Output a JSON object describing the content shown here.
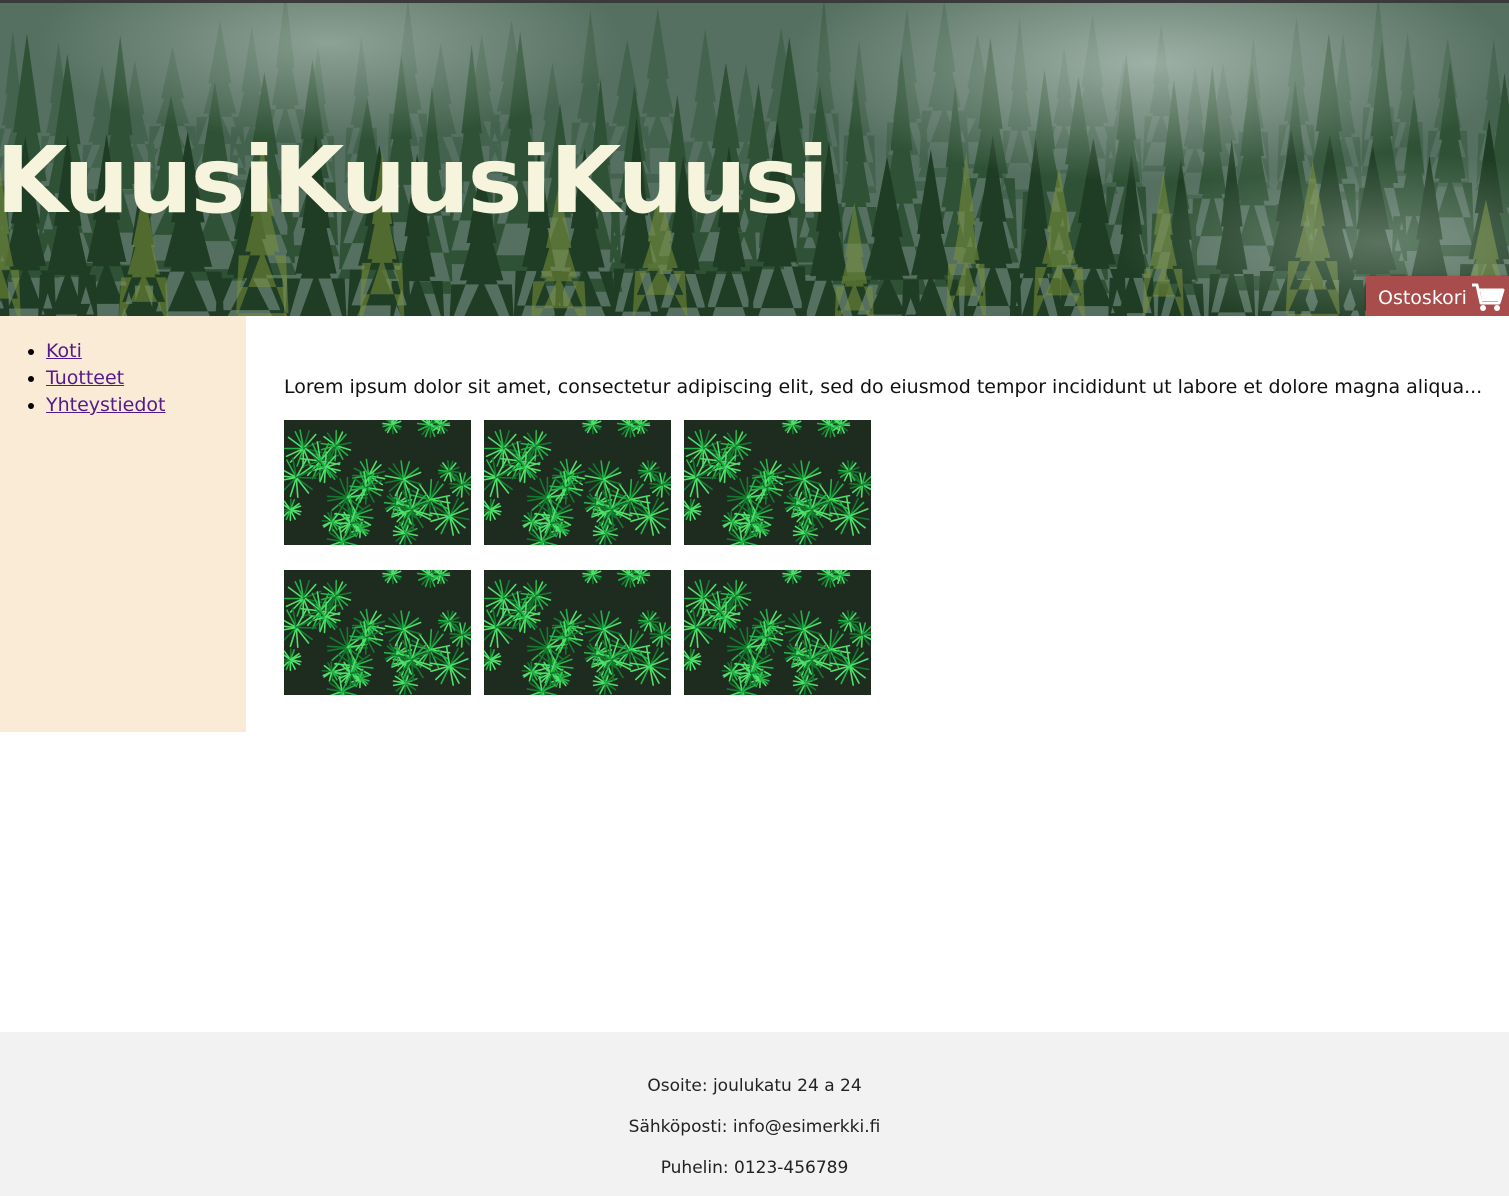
{
  "header": {
    "title": "KuusiKuusiKuusi",
    "cart_label": "Ostoskori"
  },
  "nav": {
    "items": [
      {
        "label": "Koti"
      },
      {
        "label": "Tuotteet"
      },
      {
        "label": "Yhteystiedot"
      }
    ]
  },
  "main": {
    "intro": "Lorem ipsum dolor sit amet, consectetur adipiscing elit, sed do eiusmod tempor incididunt ut labore et dolore magna aliqua..."
  },
  "footer": {
    "address": "Osoite: joulukatu 24 a 24",
    "email": "Sähköposti: info@esimerkki.fi",
    "phone": "Puhelin: 0123-456789"
  },
  "colors": {
    "title": "#f6f4dc",
    "cart_button": "#a84c4c",
    "sidebar": "#faebd7",
    "link_visited": "#551a8b",
    "footer_bg": "#f2f2f2"
  },
  "icons": {
    "cart": "shopping-cart-icon"
  }
}
